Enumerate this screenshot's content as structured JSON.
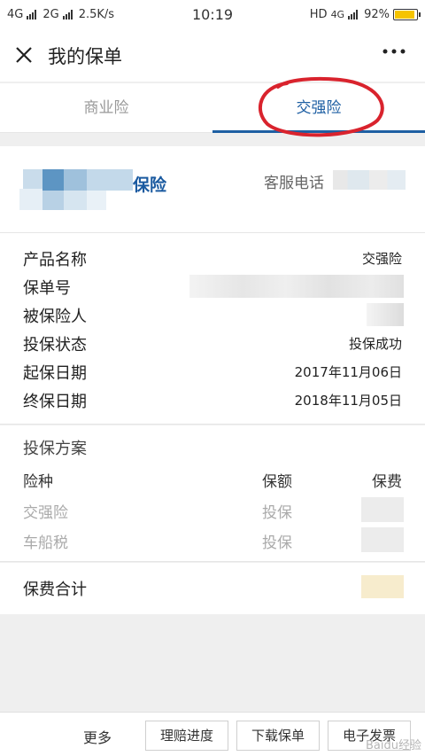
{
  "status_bar": {
    "network_1": "4G",
    "network_2": "2G",
    "speed": "2.5K/s",
    "time": "10:19",
    "hd": "HD",
    "network_3": "4G",
    "battery": "92%",
    "battery_level": 0.92
  },
  "title_bar": {
    "title": "我的保单",
    "close_icon": "close-icon",
    "more_icon": "more-dots-icon"
  },
  "tabs": [
    {
      "label": "商业险",
      "active": false
    },
    {
      "label": "交强险",
      "active": true
    }
  ],
  "insurer": {
    "name": "保险",
    "hotline_label": "客服电话"
  },
  "details": [
    {
      "label": "产品名称",
      "value": "交强险"
    },
    {
      "label": "保单号",
      "value": ""
    },
    {
      "label": "被保险人",
      "value": ""
    },
    {
      "label": "投保状态",
      "value": "投保成功"
    },
    {
      "label": "起保日期",
      "value": "2017年11月06日"
    },
    {
      "label": "终保日期",
      "value": "2018年11月05日"
    }
  ],
  "plan": {
    "title": "投保方案",
    "headers": [
      "险种",
      "保额",
      "保费"
    ],
    "rows": [
      {
        "type": "交强险",
        "amount": "投保"
      },
      {
        "type": "车船税",
        "amount": "投保"
      }
    ]
  },
  "total": {
    "label": "保费合计"
  },
  "bottom_bar": {
    "more": "更多",
    "buttons": [
      "理赔进度",
      "下载保单",
      "电子发票"
    ]
  },
  "colors": {
    "accent": "#1e5fa3",
    "annotation": "#d9232d",
    "battery": "#f5c400"
  },
  "watermark": "Baidu经验"
}
